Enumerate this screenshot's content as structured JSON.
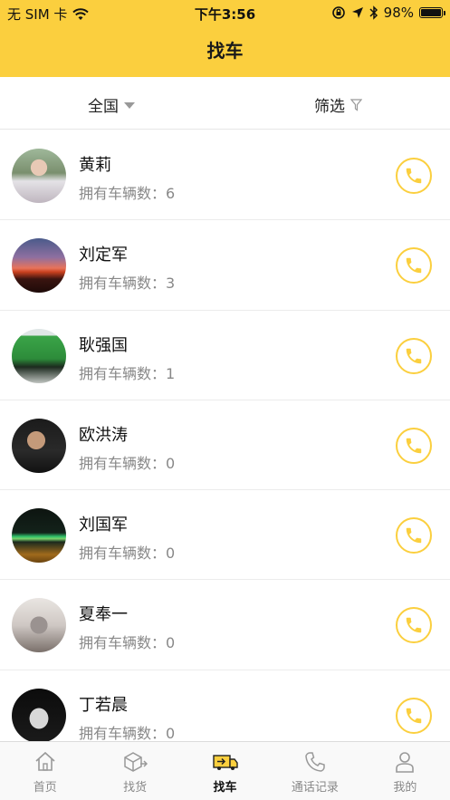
{
  "status_bar": {
    "carrier": "无 SIM 卡",
    "time": "下午3:56",
    "battery": "98%"
  },
  "header": {
    "title": "找车"
  },
  "filters": {
    "region_label": "全国",
    "filter_label": "筛选"
  },
  "drivers": [
    {
      "name": "黄莉",
      "vehicles_label": "拥有车辆数：",
      "vehicles": "6"
    },
    {
      "name": "刘定军",
      "vehicles_label": "拥有车辆数：",
      "vehicles": "3"
    },
    {
      "name": "耿强国",
      "vehicles_label": "拥有车辆数：",
      "vehicles": "1"
    },
    {
      "name": "欧洪涛",
      "vehicles_label": "拥有车辆数：",
      "vehicles": "0"
    },
    {
      "name": "刘国军",
      "vehicles_label": "拥有车辆数：",
      "vehicles": "0"
    },
    {
      "name": "夏奉一",
      "vehicles_label": "拥有车辆数：",
      "vehicles": "0"
    },
    {
      "name": "丁若晨",
      "vehicles_label": "拥有车辆数：",
      "vehicles": "0"
    }
  ],
  "tabs": [
    {
      "label": "首页",
      "icon": "home-icon"
    },
    {
      "label": "找货",
      "icon": "box-icon"
    },
    {
      "label": "找车",
      "icon": "truck-icon",
      "active": true
    },
    {
      "label": "通话记录",
      "icon": "phone-icon"
    },
    {
      "label": "我的",
      "icon": "person-icon"
    }
  ],
  "colors": {
    "accent": "#fbcf3e",
    "text_secondary": "#888888"
  }
}
